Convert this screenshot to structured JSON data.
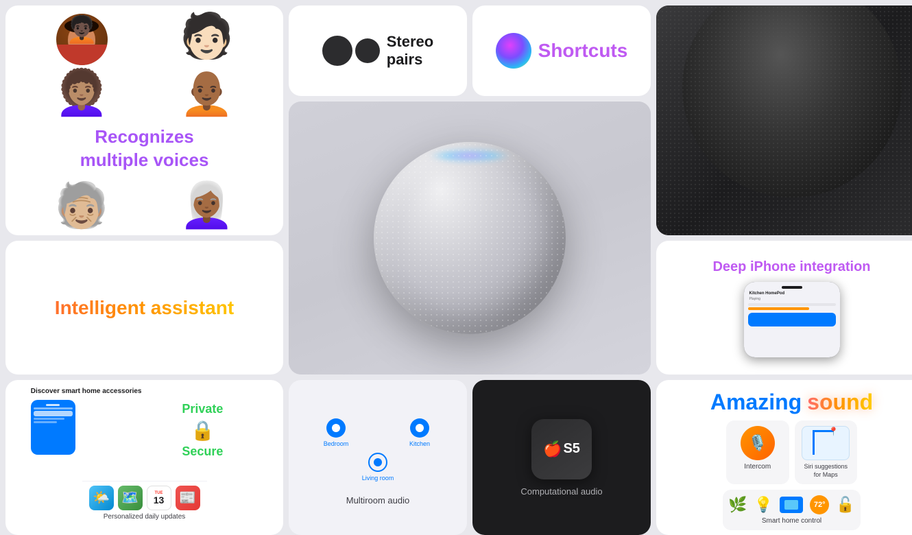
{
  "bg_color": "#e8e8ed",
  "cards": {
    "recognizes": {
      "title": "Recognizes\nmultiple voices",
      "title_color": "#a855f7"
    },
    "stereo": {
      "label": "Stereo\npairs"
    },
    "shortcuts": {
      "label": "Shortcuts"
    },
    "intelligent": {
      "label": "Intelligent assistant"
    },
    "deep_iphone": {
      "title": "Deep iPhone integration"
    },
    "amazing": {
      "word1": "Amazing",
      "word2": "sound"
    },
    "discover": {
      "title": "Discover smart home accessories"
    },
    "private_secure": {
      "private_label": "Private",
      "secure_label": "Secure"
    },
    "personalized": {
      "label": "Personalized daily updates"
    },
    "multiroom": {
      "label": "Multiroom audio",
      "rooms": [
        "Bedroom",
        "Kitchen",
        "Living room"
      ]
    },
    "computational": {
      "label": "Computational audio",
      "chip": "S5"
    },
    "intercom": {
      "label": "Intercom"
    },
    "siri_maps": {
      "label": "Siri suggestions\nfor Maps"
    },
    "smart_home": {
      "label": "Smart home control"
    }
  }
}
